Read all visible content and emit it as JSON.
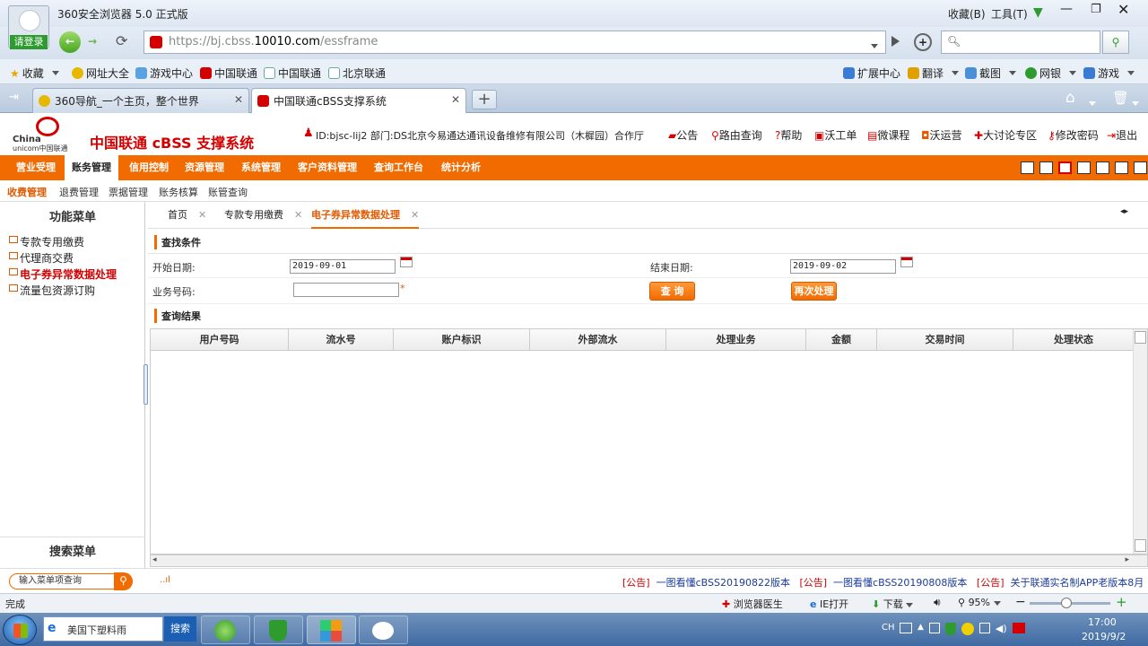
{
  "browser": {
    "title": "360安全浏览器 5.0 正式版",
    "menu_bookmarks": "收藏(B)",
    "menu_tools": "工具(T)",
    "login_label": "请登录",
    "url": "https://bj.cbss.10010.com/essframe",
    "url_prefix": "https://bj.cbss.",
    "url_domain": "10010.com",
    "url_path": "/essframe",
    "search_placeholder": "",
    "favorites": [
      "收藏",
      "网址大全",
      "游戏中心",
      "中国联通",
      "中国联通",
      "北京联通"
    ],
    "tools": [
      "扩展中心",
      "翻译",
      "截图",
      "网银",
      "游戏"
    ],
    "tabs": [
      {
        "label": "360导航_一个主页，整个世界",
        "active": false
      },
      {
        "label": "中国联通cBSS支撑系统",
        "active": true
      }
    ]
  },
  "app": {
    "logo_en_1": "China",
    "logo_en_2": "unicom中国联通",
    "system_title": "中国联通 cBSS 支撑系统",
    "user_info": "ID:bjsc-lij2 部门:DS北京今易通达通讯设备维修有限公司（木樨园）合作厅",
    "header_links": [
      "公告",
      "路由查询",
      "帮助",
      "沃工单",
      "微课程",
      "沃运营",
      "大讨论专区",
      "修改密码",
      "退出"
    ],
    "main_nav": [
      "营业受理",
      "账务管理",
      "信用控制",
      "资源管理",
      "系统管理",
      "客户资料管理",
      "查询工作台",
      "统计分析"
    ],
    "main_nav_active": "账务管理",
    "sub_nav": [
      "收费管理",
      "退费管理",
      "票据管理",
      "账务核算",
      "账管查询"
    ],
    "sidebar_title": "功能菜单",
    "sidebar_items": [
      "专款专用缴费",
      "代理商交费",
      "电子券异常数据处理",
      "流量包资源订购"
    ],
    "sidebar_active": "电子券异常数据处理",
    "search_menu_title": "搜索菜单",
    "menu_search_placeholder": "输入菜单项查询",
    "page_tabs": [
      "首页",
      "专款专用缴费",
      "电子券异常数据处理"
    ],
    "page_tab_active": "电子券异常数据处理",
    "query_title": "查找条件",
    "start_date_label": "开始日期:",
    "start_date": "2019-09-01",
    "end_date_label": "结束日期:",
    "end_date": "2019-09-02",
    "biz_number_label": "业务号码:",
    "biz_number": "",
    "query_button": "查 询",
    "reprocess_button": "再次处理",
    "result_title": "查询结果",
    "columns": [
      "用户号码",
      "流水号",
      "账户标识",
      "外部流水",
      "处理业务",
      "金额",
      "交易时间",
      "处理状态"
    ],
    "marquee": "[公告]  一图看懂cBSS20190822版本  [公告]  一图看懂cBSS20190808版本  [公告]  关于联通实名制APP老版本8月",
    "marquee_items": [
      "[公告]",
      "一图看懂cBSS20190822版本",
      "[公告]",
      "一图看懂cBSS20190808版本",
      "[公告]",
      "关于联通实名制APP老版本8月"
    ]
  },
  "statusbar": {
    "status": "完成",
    "doctor": "浏览器医生",
    "ie_open": "IE打开",
    "download": "下载",
    "zoom": "95%"
  },
  "taskbar": {
    "search_text": "美国下塑料雨",
    "search_button": "搜索",
    "ime": "CH",
    "time": "17:00",
    "date": "2019/9/2"
  },
  "colors": {
    "brand_orange": "#f26b00",
    "brand_red": "#d40000"
  }
}
